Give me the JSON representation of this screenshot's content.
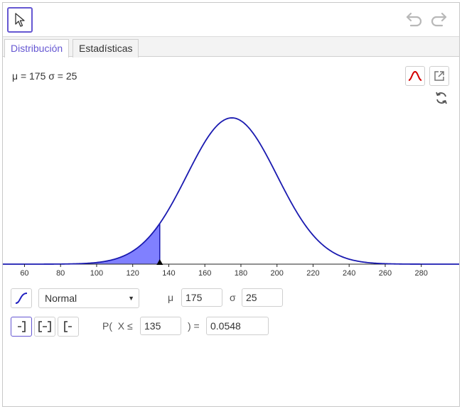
{
  "toolbar": {
    "move_tool_icon": "pointer-arrow-icon",
    "undo_icon": "undo-icon",
    "redo_icon": "redo-icon"
  },
  "tabs": [
    {
      "label": "Distribución",
      "active": true
    },
    {
      "label": "Estadísticas",
      "active": false
    }
  ],
  "params_label": "μ = 175 σ = 25",
  "plot_buttons": {
    "normal_overlay_icon": "bell-curve-icon",
    "export_icon": "export-icon",
    "reset_icon": "refresh-icon"
  },
  "colors": {
    "accent": "#6557d2",
    "curve": "#1a1ab0",
    "shade": "#8080ff",
    "overlay_icon": "#d40000",
    "axis": "#222222"
  },
  "chart_data": {
    "type": "area",
    "distribution": "Normal",
    "mean": 175,
    "sd": 25,
    "xlim": [
      48,
      301
    ],
    "x_ticks": [
      "60",
      "80",
      "100",
      "120",
      "140",
      "160",
      "180",
      "200",
      "220",
      "240",
      "260",
      "280"
    ],
    "shade_upper": 135,
    "marker_x": 135,
    "probability": 0.0548
  },
  "distribution_row": {
    "cumulative_icon": "cumulative-curve-icon",
    "type_selected": "Normal",
    "mu_label": "μ",
    "mu_value": "175",
    "sigma_label": "σ",
    "sigma_value": "25"
  },
  "probability_row": {
    "left_sided_icon": "left-sided-interval-icon",
    "two_sided_icon": "interval-icon",
    "right_sided_icon": "right-sided-interval-icon",
    "prob_prefix": "P(  X ≤",
    "x_value": "135",
    "equals": ") =",
    "result": "0.0548"
  }
}
